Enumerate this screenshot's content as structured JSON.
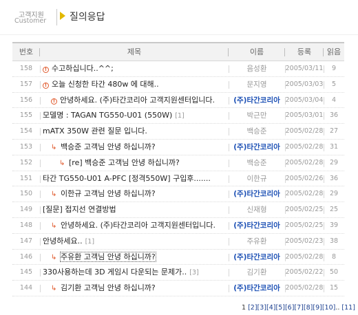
{
  "header": {
    "category_ko": "고객지원",
    "category_en": "Customer",
    "title": "질의응답"
  },
  "table": {
    "columns": {
      "no": "번호",
      "title": "제목",
      "name": "이름",
      "date": "등록",
      "reads": "읽음"
    },
    "rows": [
      {
        "no": "158",
        "icon": "new",
        "indent": 0,
        "title": "수고하십니다..^^;",
        "comments": "",
        "name": "음성환",
        "staff": false,
        "date": "2005/03/11",
        "reads": "9"
      },
      {
        "no": "157",
        "icon": "new",
        "indent": 0,
        "title": "오늘 신청한 타간 480w 에 대해..",
        "comments": "",
        "name": "문지영",
        "staff": false,
        "date": "2005/03/03",
        "reads": "5"
      },
      {
        "no": "156",
        "icon": "new",
        "indent": 1,
        "title": "안녕하세요. (주)타간코리아 고객지원센터입니다.",
        "comments": "",
        "name": "(주)타간코리아",
        "staff": true,
        "date": "2005/03/04",
        "reads": "4"
      },
      {
        "no": "155",
        "icon": "",
        "indent": 0,
        "title": "모델명 : TAGAN TG550-U01 (550W)",
        "comments": "[1]",
        "name": "박근만",
        "staff": false,
        "date": "2005/03/01",
        "reads": "36"
      },
      {
        "no": "154",
        "icon": "",
        "indent": 0,
        "title": "mATX 350W 관련 질문 입니다.",
        "comments": "",
        "name": "백승준",
        "staff": false,
        "date": "2005/02/28",
        "reads": "27"
      },
      {
        "no": "153",
        "icon": "reply",
        "indent": 1,
        "title": "백승준 고객님 안녕 하십니까?",
        "comments": "",
        "name": "(주)타간코리아",
        "staff": true,
        "date": "2005/02/28",
        "reads": "31"
      },
      {
        "no": "152",
        "icon": "reply",
        "indent": 2,
        "title": "[re] 백승준 고객님 안녕 하십니까?",
        "comments": "",
        "name": "백승준",
        "staff": false,
        "date": "2005/02/28",
        "reads": "29"
      },
      {
        "no": "151",
        "icon": "",
        "indent": 0,
        "title": "타간 TG550-U01 A-PFC [정격550W] 구입후.......",
        "comments": "",
        "name": "이한규",
        "staff": false,
        "date": "2005/02/26",
        "reads": "36"
      },
      {
        "no": "150",
        "icon": "reply",
        "indent": 1,
        "title": "이한규 고객님 안녕 하십니까?",
        "comments": "",
        "name": "(주)타간코리아",
        "staff": true,
        "date": "2005/02/28",
        "reads": "29"
      },
      {
        "no": "149",
        "icon": "",
        "indent": 0,
        "title": "[질문] 접지선 연결방법",
        "comments": "",
        "name": "신재형",
        "staff": false,
        "date": "2005/02/25",
        "reads": "25"
      },
      {
        "no": "148",
        "icon": "reply",
        "indent": 1,
        "title": "안녕하세요. (주)타간코리아 고객지원센터입니다.",
        "comments": "",
        "name": "(주)타간코리아",
        "staff": true,
        "date": "2005/02/25",
        "reads": "39"
      },
      {
        "no": "147",
        "icon": "",
        "indent": 0,
        "title": "안녕하세요..",
        "comments": "[1]",
        "name": "주유환",
        "staff": false,
        "date": "2005/02/23",
        "reads": "38"
      },
      {
        "no": "146",
        "icon": "reply",
        "indent": 1,
        "title": "주유환 고객님 안녕 하십니까?",
        "comments": "",
        "name": "(주)타간코리아",
        "staff": true,
        "date": "2005/02/28",
        "reads": "8"
      },
      {
        "no": "145",
        "icon": "",
        "indent": 0,
        "title": "330사용하는데 3D 게임시 다운되는 문제가..",
        "comments": "[3]",
        "name": "김기환",
        "staff": false,
        "date": "2005/02/22",
        "reads": "50"
      },
      {
        "no": "144",
        "icon": "reply",
        "indent": 1,
        "title": "김기환 고객님 안녕 하십니까?",
        "comments": "",
        "name": "(주)타간코리아",
        "staff": true,
        "date": "2005/02/28",
        "reads": "15"
      }
    ]
  },
  "pagination": {
    "current": "1",
    "pages": [
      "[2]",
      "[3]",
      "[4]",
      "[5]",
      "[6]",
      "[7]",
      "[8]",
      "[9]",
      "[10]"
    ],
    "ellipsis": "..",
    "last": "[11]"
  },
  "colors": {
    "staff_name": "#1b4fb4",
    "new_icon": "#e0582a",
    "header_bg": "#f2f2f2"
  }
}
